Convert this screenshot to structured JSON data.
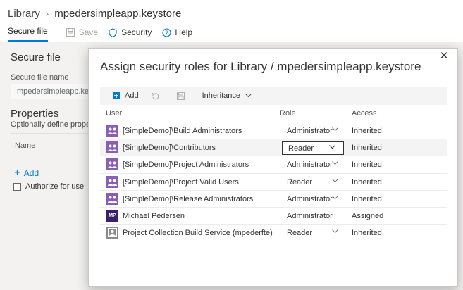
{
  "breadcrumb": {
    "root": "Library",
    "current": "mpedersimpleapp.keystore"
  },
  "toolbar": {
    "tab_label": "Secure file",
    "save_label": "Save",
    "security_label": "Security",
    "help_label": "Help"
  },
  "form": {
    "section_title": "Secure file",
    "file_name_label": "Secure file name",
    "file_name_value": "mpedersimpleapp.keystore",
    "properties_title": "Properties",
    "properties_subtitle": "Optionally define properties",
    "name_column": "Name",
    "add_label": "Add",
    "authorize_label": "Authorize for use in all pipelines"
  },
  "dialog": {
    "title": "Assign security roles for Library / mpedersimpleapp.keystore",
    "close_icon": "close-icon",
    "toolbar": {
      "add_label": "Add",
      "inheritance_label": "Inheritance"
    },
    "columns": {
      "user": "User",
      "role": "Role",
      "access": "Access"
    },
    "rows": [
      {
        "user": "[SimpleDemo]\\Build Administrators",
        "role": "Administrator",
        "access": "Inherited",
        "avatar": "group-icon"
      },
      {
        "user": "[SimpleDemo]\\Contributors",
        "role": "Reader",
        "access": "Inherited",
        "avatar": "group-icon"
      },
      {
        "user": "[SimpleDemo]\\Project Administrators",
        "role": "Administrator",
        "access": "Inherited",
        "avatar": "group-icon"
      },
      {
        "user": "[SimpleDemo]\\Project Valid Users",
        "role": "Reader",
        "access": "Inherited",
        "avatar": "group-icon"
      },
      {
        "user": "[SimpleDemo]\\Release Administrators",
        "role": "Administrator",
        "access": "Inherited",
        "avatar": "group-icon"
      },
      {
        "user": "Michael Pedersen",
        "role": "Administrator",
        "access": "Assigned",
        "avatar": "user-initials",
        "initials": "MP"
      },
      {
        "user": "Project Collection Build Service (mpederfte)",
        "role": "Reader",
        "access": "Inherited",
        "avatar": "service-icon"
      }
    ]
  },
  "colors": {
    "accent": "#0078d4",
    "group_avatar": "#8a5fb3",
    "user_avatar": "#3a1f6b",
    "service_avatar": "#8a8a8a"
  }
}
